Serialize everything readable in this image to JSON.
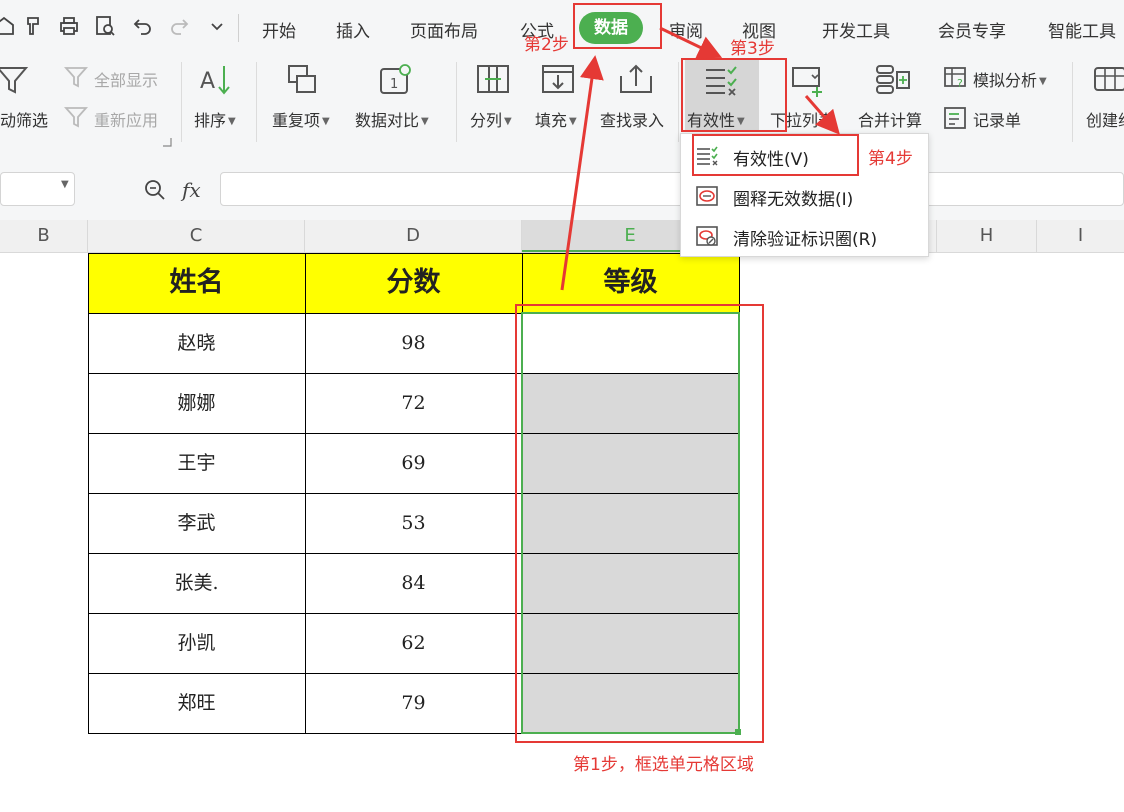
{
  "menu_tabs": [
    "开始",
    "插入",
    "页面布局",
    "公式",
    "数据",
    "审阅",
    "视图",
    "开发工具",
    "会员专享",
    "智能工具"
  ],
  "ribbon": {
    "auto_filter": "动筛选",
    "show_all": "全部显示",
    "reapply": "重新应用",
    "sort": "排序",
    "duplicates": "重复项",
    "compare": "数据对比",
    "split": "分列",
    "fill": "填充",
    "lookup_entry": "查找录入",
    "validity": "有效性",
    "dropdown_list": "下拉列表",
    "consolidate": "合并计算",
    "what_if": "模拟分析",
    "record_form": "记录单",
    "create": "创建组"
  },
  "formula_bar": {
    "fx_label": "fx"
  },
  "columns": [
    "B",
    "C",
    "D",
    "E",
    "H",
    "I"
  ],
  "table": {
    "headers": [
      "姓名",
      "分数",
      "等级"
    ],
    "rows": [
      [
        "赵晓",
        "98",
        ""
      ],
      [
        "娜娜",
        "72",
        ""
      ],
      [
        "王宇",
        "69",
        ""
      ],
      [
        "李武",
        "53",
        ""
      ],
      [
        "张美.",
        "84",
        ""
      ],
      [
        "孙凯",
        "62",
        ""
      ],
      [
        "郑旺",
        "79",
        ""
      ]
    ]
  },
  "dropdown": {
    "items": [
      "有效性(V)",
      "圈释无效数据(I)",
      "清除验证标识圈(R)"
    ]
  },
  "annotations": {
    "step1": "第1步，框选单元格区域",
    "step2": "第2步",
    "step3": "第3步",
    "step4": "第4步"
  },
  "colors": {
    "accent_green": "#4caf50",
    "annotation_red": "#e53935",
    "header_yellow": "#ffff00",
    "selection_gray": "#d9d9d9",
    "selection_border": "#4caf50"
  }
}
